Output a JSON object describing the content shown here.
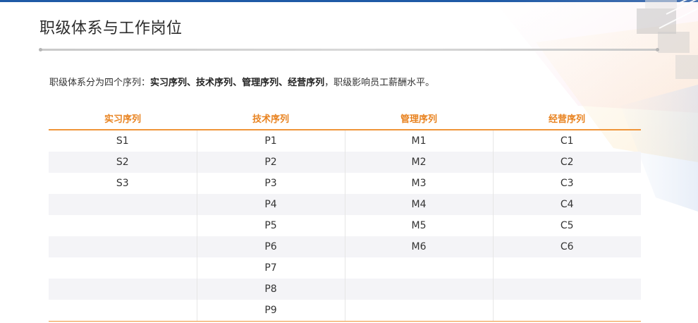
{
  "page": {
    "title": "职级体系与工作岗位",
    "intro": {
      "prefix": "职级体系分为四个序列：",
      "seq_1": "实习序列",
      "sep_1": "、",
      "seq_2": "技术序列",
      "sep_2": "、",
      "seq_3": "管理序列",
      "sep_3": "、",
      "seq_4": "经营序列",
      "suffix": "，职级影响员工薪酬水平。"
    }
  },
  "colors": {
    "accent_orange": "#e8821f",
    "top_bar_blue": "#1f5aa6",
    "row_stripe": "#f4f4f7"
  },
  "table": {
    "headers": [
      "实习序列",
      "技术序列",
      "管理序列",
      "经营序列"
    ],
    "rows": [
      [
        "S1",
        "P1",
        "M1",
        "C1"
      ],
      [
        "S2",
        "P2",
        "M2",
        "C2"
      ],
      [
        "S3",
        "P3",
        "M3",
        "C3"
      ],
      [
        "",
        "P4",
        "M4",
        "C4"
      ],
      [
        "",
        "P5",
        "M5",
        "C5"
      ],
      [
        "",
        "P6",
        "M6",
        "C6"
      ],
      [
        "",
        "P7",
        "",
        ""
      ],
      [
        "",
        "P8",
        "",
        ""
      ],
      [
        "",
        "P9",
        "",
        ""
      ]
    ]
  }
}
